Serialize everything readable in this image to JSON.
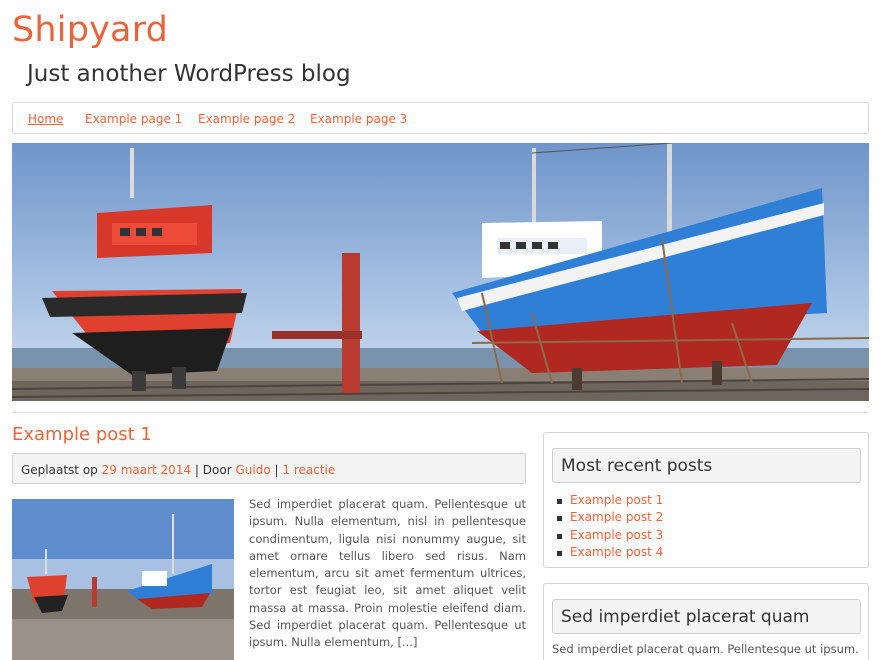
{
  "site": {
    "title": "Shipyard",
    "tagline": "Just another WordPress blog"
  },
  "nav": {
    "items": [
      "Home",
      "Example page 1",
      "Example page 2",
      "Example page 3"
    ],
    "current": "Home"
  },
  "post": {
    "title": "Example post 1",
    "meta_prefix": "Geplaatst op",
    "date": "29 maart 2014",
    "sep1": "|",
    "by_label": "Door",
    "author": "Guido",
    "sep2": "|",
    "comments": "1 reactie",
    "excerpt": "Sed imperdiet placerat quam. Pellentesque ut ipsum. Nulla elementum, nisl in pellentesque condimentum, ligula nisi nonummy augue, sit amet ornare tellus libero sed risus. Nam elementum, arcu sit amet fermentum ultrices, tortor est feugiat leo, sit amet aliquet velit massa at massa. Proin molestie eleifend diam. Sed imperdiet placerat quam. Pellentesque ut ipsum. Nulla elementum, [...]"
  },
  "sidebar": {
    "recent": {
      "title": "Most recent posts",
      "items": [
        "Example post 1",
        "Example post 2",
        "Example post 3",
        "Example post 4"
      ]
    },
    "text_widget": {
      "title": "Sed imperdiet placerat quam",
      "text": "Sed imperdiet placerat quam. Pellentesque ut ipsum."
    }
  },
  "colors": {
    "accent": "#e8643c",
    "text": "#333333",
    "panel_bg": "#f4f4f4",
    "border": "#d6d6d6"
  }
}
